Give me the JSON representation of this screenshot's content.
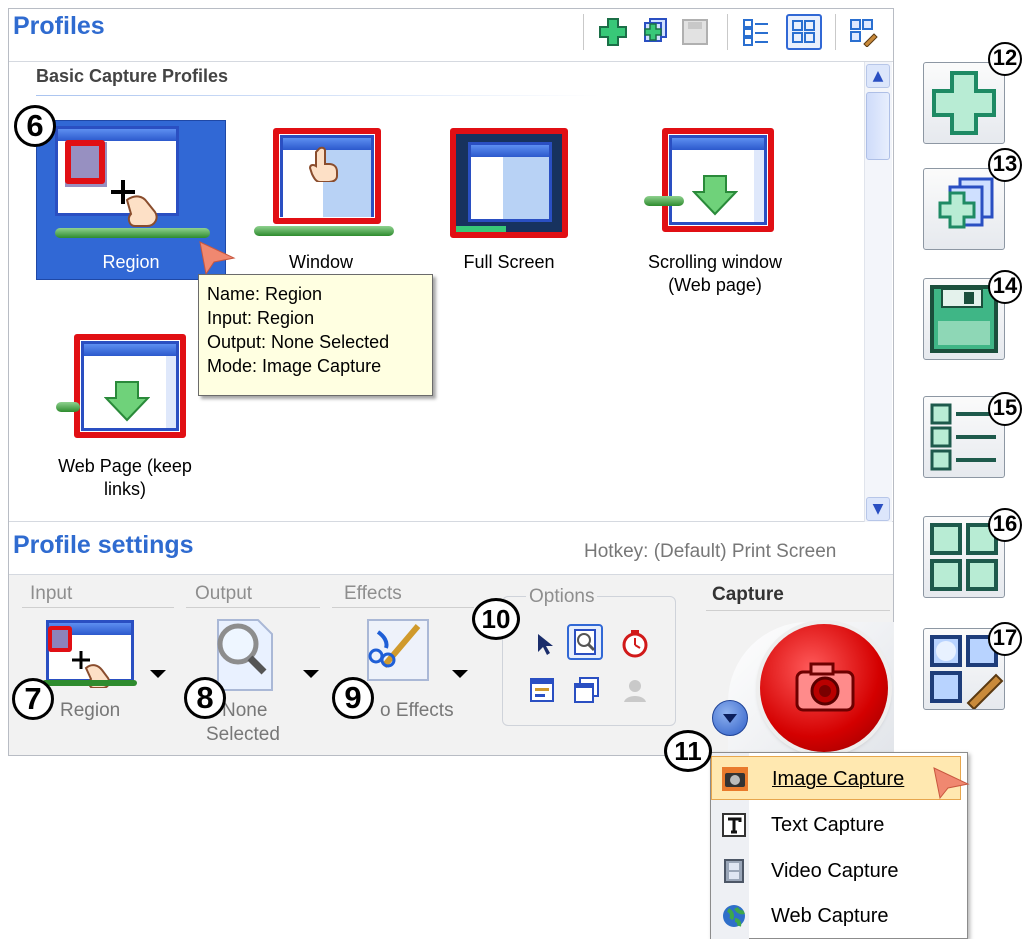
{
  "panel": {
    "title": "Profiles",
    "group_heading": "Basic Capture Profiles",
    "profiles": [
      {
        "label": "Region"
      },
      {
        "label": "Window"
      },
      {
        "label": "Full Screen"
      },
      {
        "label": "Scrolling window (Web page)"
      },
      {
        "label": "Web Page (keep links)"
      }
    ],
    "tooltip": {
      "line1": "Name: Region",
      "line2": "Input: Region",
      "line3": "Output: None Selected",
      "line4": "Mode: Image Capture"
    }
  },
  "settings": {
    "title": "Profile settings",
    "hotkey": "Hotkey: (Default) Print Screen",
    "sections": {
      "input": "Input",
      "output": "Output",
      "effects": "Effects",
      "options": "Options",
      "capture": "Capture"
    },
    "input_value": "Region",
    "output_value_1": "None",
    "output_value_2": "Selected",
    "effects_value": "o Effects"
  },
  "capture_menu": {
    "items": [
      {
        "label": "Image Capture",
        "icon": "camera-icon"
      },
      {
        "label": "Text Capture",
        "icon": "text-t-icon"
      },
      {
        "label": "Video Capture",
        "icon": "film-icon"
      },
      {
        "label": "Web Capture",
        "icon": "globe-icon"
      }
    ]
  },
  "callouts": [
    "6",
    "7",
    "8",
    "9",
    "10",
    "11",
    "12",
    "13",
    "14",
    "15",
    "16",
    "17"
  ],
  "colors": {
    "accent_blue": "#2f6bd0",
    "selection": "#3168d5",
    "highlight_red": "#e10f14",
    "tooltip_bg": "#ffffe1",
    "menu_highlight": "#ffe8b0"
  }
}
